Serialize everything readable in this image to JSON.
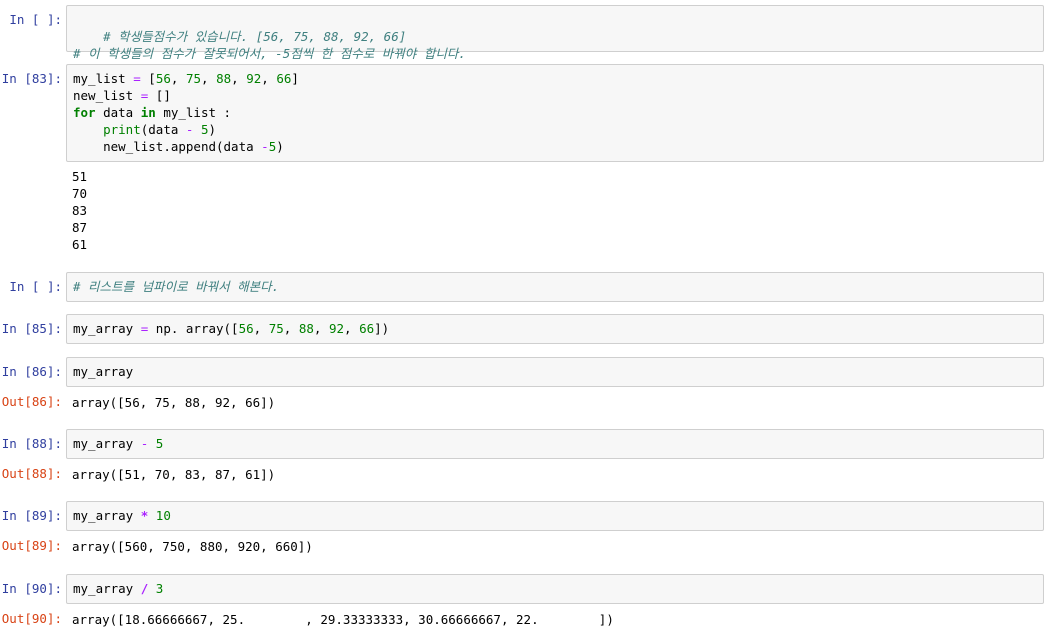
{
  "cells": [
    {
      "prompt": "In [ ]:",
      "lines": [
        "# 학생들점수가 있습니다. [56, 75, 88, 92, 66]",
        "# 이 학생들의 점수가 잘못되어서, -5점씩 한 점수로 바꿔야 합니다."
      ]
    },
    {
      "prompt": "In [83]:",
      "code": {
        "l1_a": "my_list ",
        "l1_eq": "=",
        "l1_b": " [",
        "n56": "56",
        "n75": "75",
        "n88": "88",
        "n92": "92",
        "n66": "66",
        "l1_close": "]",
        "l2_a": "new_list ",
        "l2_eq": "=",
        "l2_b": " []",
        "l3_for": "for",
        "l3_a": " data ",
        "l3_in": "in",
        "l3_b": " my_list :",
        "l4_print": "print",
        "l4_a": "(data ",
        "l4_minus": "-",
        "l4_sp": " ",
        "l4_n": "5",
        "l4_close": ")",
        "l5_a": "new_list.append(data ",
        "l5_minus": "-",
        "l5_n": "5",
        "l5_close": ")"
      },
      "output": [
        "51",
        "70",
        "83",
        "87",
        "61"
      ]
    },
    {
      "prompt": "In [ ]:",
      "comment": "# 리스트를 넘파이로 바꿔서 해본다."
    },
    {
      "prompt": "In [85]:",
      "code": {
        "a": "my_array ",
        "eq": "=",
        "b": " np. array([",
        "n1": "56",
        "n2": "75",
        "n3": "88",
        "n4": "92",
        "n5": "66",
        "close": "])"
      }
    },
    {
      "prompt": "In [86]:",
      "code": "my_array",
      "out_prompt": "Out[86]:",
      "output": "array([56, 75, 88, 92, 66])"
    },
    {
      "prompt": "In [88]:",
      "code": {
        "a": "my_array ",
        "op": "-",
        "sp": " ",
        "n": "5"
      },
      "out_prompt": "Out[88]:",
      "output": "array([51, 70, 83, 87, 61])"
    },
    {
      "prompt": "In [89]:",
      "code": {
        "a": "my_array ",
        "op": "*",
        "sp": " ",
        "n": "10"
      },
      "out_prompt": "Out[89]:",
      "output": "array([560, 750, 880, 920, 660])"
    },
    {
      "prompt": "In [90]:",
      "code": {
        "a": "my_array ",
        "op": "/",
        "sp": " ",
        "n": "3"
      },
      "out_prompt": "Out[90]:",
      "output": "array([18.66666667, 25.        , 29.33333333, 30.66666667, 22.        ])"
    }
  ]
}
